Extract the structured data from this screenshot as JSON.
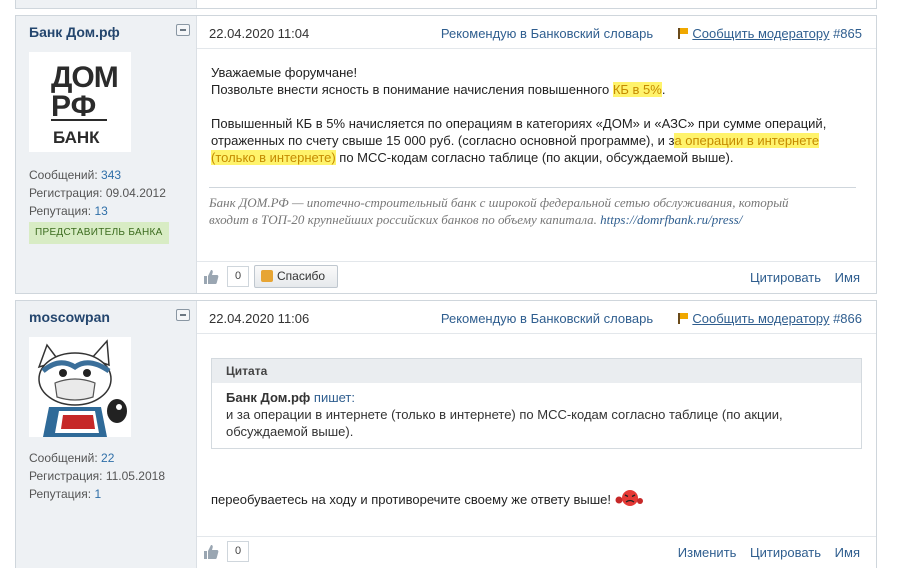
{
  "posts": [
    {
      "username": "Банк Дом.рф",
      "date": "22.04.2020 11:04",
      "recommend": "Рекомендую в Банковский словарь",
      "report": "Сообщить модератору",
      "number": "#865",
      "stats": {
        "messages_label": "Сообщений:",
        "messages": "343",
        "reg_label": "Регистрация:",
        "reg": "09.04.2012",
        "rep_label": "Репутация:",
        "rep": "13"
      },
      "badge": "ПРЕДСТАВИТЕЛЬ БАНКА",
      "avatar": {
        "line1": "ДОМ",
        "line2": "РФ",
        "bank": "БАНК"
      },
      "body": {
        "p1_line1": "Уважаемые форумчане!",
        "p1_line2_pre": "Позвольте внести ясность в понимание начисления повышенного ",
        "p1_line2_hl": "КБ в 5%",
        "p1_line2_post": ".",
        "p2_line1": "Повышенный КБ в 5% начисляется по операциям в категориях «ДОМ» и «АЗС» при сумме операций,",
        "p2_line2_pre": "отраженных по счету свыше 15 000 руб. (согласно основной программе), и з",
        "p2_line2_hl": "а операции в интернете",
        "p2_line3_hl": "(только в интернете)",
        "p2_line3_post": " по МСС-кодам согласно таблице (по акции, обсуждаемой выше)."
      },
      "signature": {
        "line1": "Банк ДОМ.РФ — ипотечно-строительный банк с широкой федеральной сетью обслуживания, который",
        "line2": "входит в ТОП-20 крупнейших российских банков по объему капитала. ",
        "link": "https://domrfbank.ru/press/"
      },
      "likes": "0",
      "thanks": "Спасибо",
      "actions": [
        "Цитировать",
        "Имя"
      ]
    },
    {
      "username": "moscowpan",
      "date": "22.04.2020 11:06",
      "recommend": "Рекомендую в Банковский словарь",
      "report": "Сообщить модератору",
      "number": "#866",
      "stats": {
        "messages_label": "Сообщений:",
        "messages": "22",
        "reg_label": "Регистрация:",
        "reg": "11.05.2018",
        "rep_label": "Репутация:",
        "rep": "1"
      },
      "quote": {
        "header": "Цитата",
        "author": "Банк Дом.рф",
        "wrote": "пишет:",
        "line1": "и за операции в интернете (только в интернете) по МСС-кодам согласно таблице (по акции,",
        "line2": "обсуждаемой выше)."
      },
      "reply": "переобуваетесь на ходу и противоречите своему же ответу выше!",
      "likes": "0",
      "actions": [
        "Изменить",
        "Цитировать",
        "Имя"
      ]
    }
  ],
  "colors": {
    "link": "#2f5e8f",
    "highlight": "#fff36b",
    "highlight_text": "#c58b00",
    "sidebar": "#eef1f4",
    "badge": "#d8ecc4"
  }
}
